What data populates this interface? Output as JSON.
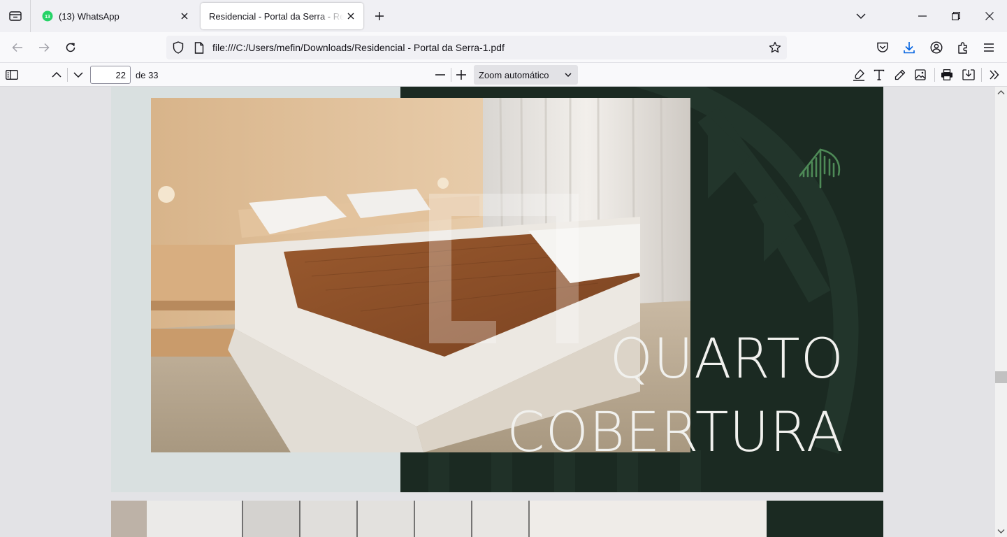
{
  "browser": {
    "tabs": [
      {
        "title": "(13) WhatsApp",
        "badge": "13"
      },
      {
        "title": "Residencial - Portal da Serra - Residencial - Portal da Serra-1.pdf"
      }
    ],
    "url": "file:///C:/Users/mefin/Downloads/Residencial - Portal da Serra-1.pdf"
  },
  "pdf_toolbar": {
    "page_number": "22",
    "page_total": "de 33",
    "zoom": "Zoom automático"
  },
  "document": {
    "slide_title_line1": "QUARTO",
    "slide_title_line2": "COBERTURA"
  },
  "colors": {
    "accent_dark_green": "#1b2a22",
    "logo_green": "#4e8a57",
    "whatsapp_green": "#25d366",
    "download_blue": "#0061e0"
  }
}
